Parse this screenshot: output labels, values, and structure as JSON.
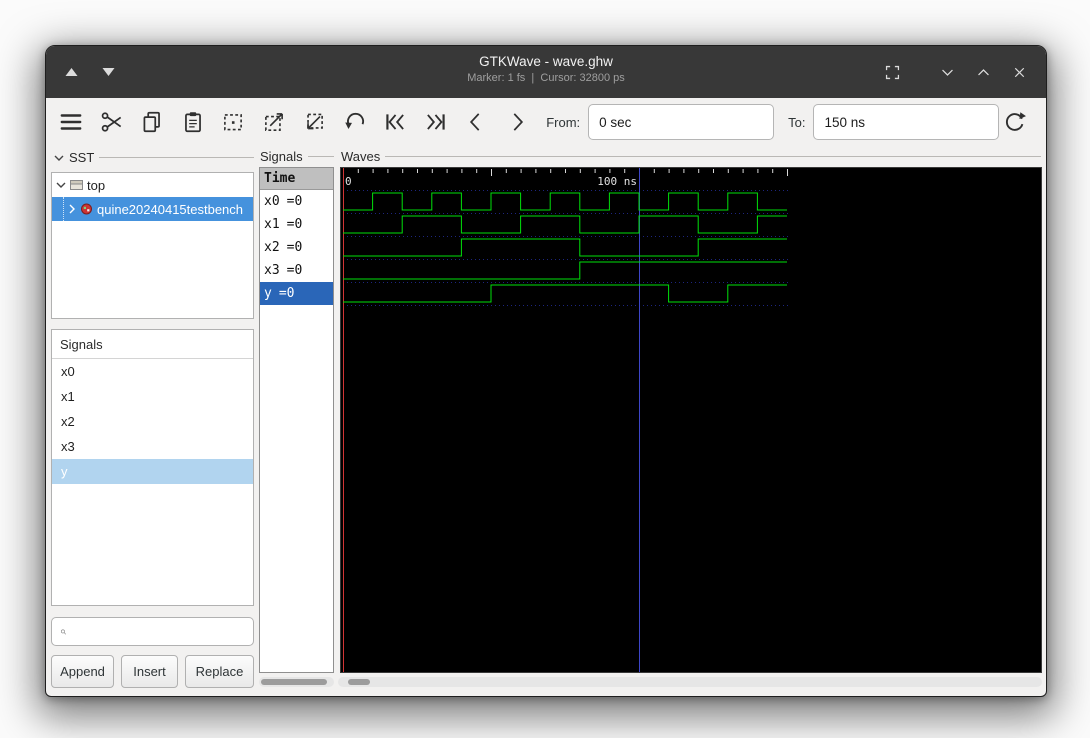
{
  "window": {
    "title": "GTKWave - wave.ghw",
    "statusbar": "Marker: 1 fs  |  Cursor: 32800 ps",
    "titlebar_color": "#383838"
  },
  "toolbar": {
    "from_label": "From:",
    "from_value": "0 sec",
    "to_label": "To:",
    "to_value": "150 ns"
  },
  "sst_panel": {
    "header": "SST",
    "root_label": "top",
    "child_label": "quine20240415testbench"
  },
  "signal_list": {
    "header": "Signals",
    "items": [
      "x0",
      "x1",
      "x2",
      "x3",
      "y"
    ],
    "selected_item": "y",
    "search_value": "",
    "buttons": {
      "append": "Append",
      "insert": "Insert",
      "replace": "Replace"
    }
  },
  "name_panel": {
    "label": "Signals",
    "time_header": "Time",
    "rows": [
      {
        "name": "x0",
        "value": "=0"
      },
      {
        "name": "x1",
        "value": "=0"
      },
      {
        "name": "x2",
        "value": "=0"
      },
      {
        "name": "x3",
        "value": "=0"
      },
      {
        "name": "y",
        "value": "=0",
        "selected": true
      }
    ]
  },
  "waves": {
    "label": "Waves",
    "view_start_ns": 0,
    "view_end_ns": 150,
    "tick_labels": [
      {
        "ns": 0,
        "text": "0"
      },
      {
        "ns": 100,
        "text": "100 ns"
      }
    ],
    "marker_ns": 0,
    "vertical_line_ns": 100,
    "colors": {
      "trace": "#00e10a",
      "marker": "#d03535",
      "vertical_line": "#3d46c8",
      "canvas": "#000000",
      "row_selection_blue": "#2a66b8",
      "tree_selection_blue": "#4592dd",
      "list_selection_blue": "#b1d4ef"
    },
    "signals": [
      {
        "name": "x0",
        "wave": [
          [
            0,
            0
          ],
          [
            10,
            1
          ],
          [
            20,
            0
          ],
          [
            30,
            1
          ],
          [
            40,
            0
          ],
          [
            50,
            1
          ],
          [
            60,
            0
          ],
          [
            70,
            1
          ],
          [
            80,
            0
          ],
          [
            90,
            1
          ],
          [
            100,
            0
          ],
          [
            110,
            1
          ],
          [
            120,
            0
          ],
          [
            130,
            1
          ],
          [
            140,
            0
          ]
        ]
      },
      {
        "name": "x1",
        "wave": [
          [
            0,
            0
          ],
          [
            20,
            1
          ],
          [
            40,
            0
          ],
          [
            60,
            1
          ],
          [
            80,
            0
          ],
          [
            100,
            1
          ],
          [
            120,
            0
          ],
          [
            140,
            1
          ]
        ]
      },
      {
        "name": "x2",
        "wave": [
          [
            0,
            0
          ],
          [
            40,
            1
          ],
          [
            80,
            0
          ],
          [
            120,
            1
          ]
        ]
      },
      {
        "name": "x3",
        "wave": [
          [
            0,
            0
          ],
          [
            80,
            1
          ]
        ]
      },
      {
        "name": "y",
        "wave": [
          [
            0,
            0
          ],
          [
            50,
            1
          ],
          [
            110,
            0
          ],
          [
            130,
            1
          ]
        ]
      }
    ]
  }
}
